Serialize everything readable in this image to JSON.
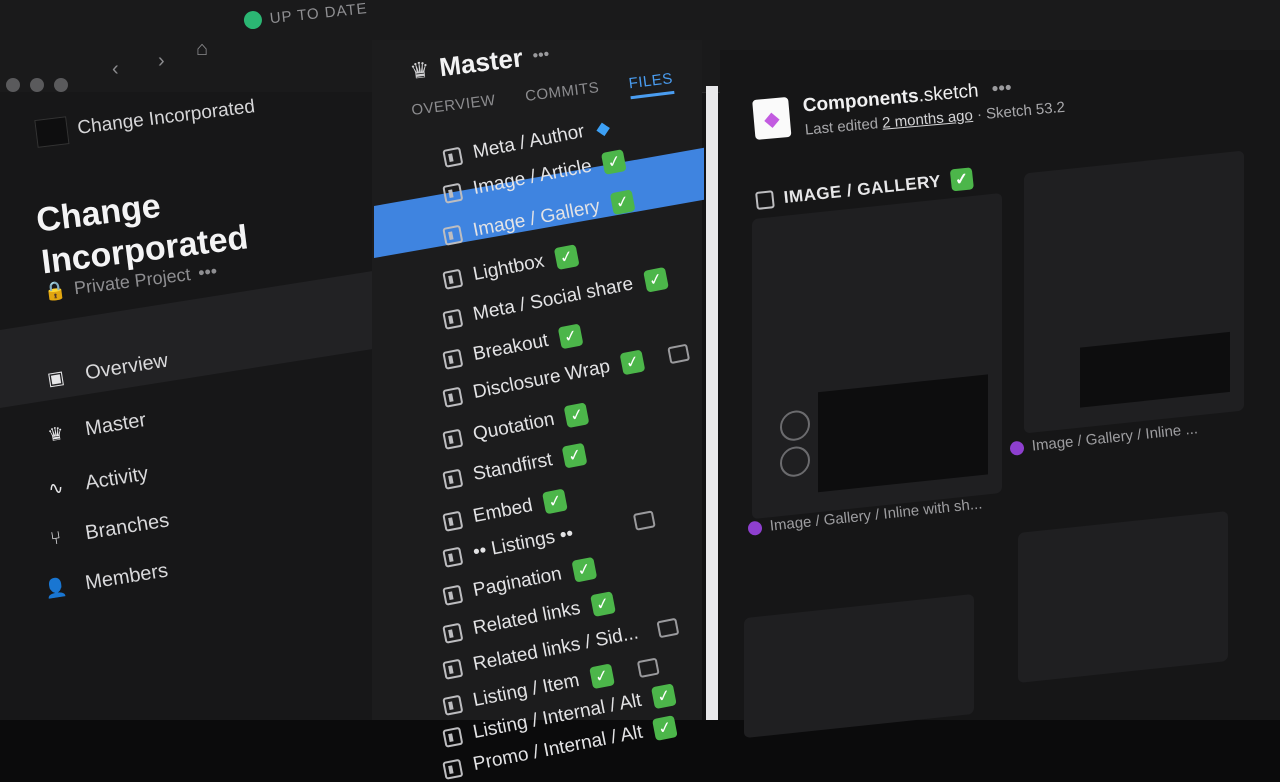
{
  "topbar": {
    "status_text": "UP TO DATE"
  },
  "sidebar": {
    "org_name": "Change Incorporated",
    "project_title": "Change Incorporated",
    "project_visibility": "Private Project",
    "items": [
      {
        "label": "Overview",
        "icon": "document-icon"
      },
      {
        "label": "Master",
        "icon": "crown-icon"
      },
      {
        "label": "Activity",
        "icon": "pulse-icon"
      },
      {
        "label": "Branches",
        "icon": "branch-icon"
      },
      {
        "label": "Members",
        "icon": "user-icon"
      }
    ]
  },
  "middle": {
    "branch_title": "Master",
    "tabs": [
      {
        "label": "OVERVIEW"
      },
      {
        "label": "COMMITS"
      },
      {
        "label": "FILES"
      }
    ],
    "files": [
      {
        "label": "Meta / Author"
      },
      {
        "label": "Image / Article"
      },
      {
        "label": "Image / Gallery"
      },
      {
        "label": "Lightbox"
      },
      {
        "label": "Meta / Social share"
      },
      {
        "label": "Breakout"
      },
      {
        "label": "Disclosure Wrap"
      },
      {
        "label": "Quotation"
      },
      {
        "label": "Standfirst"
      },
      {
        "label": "Embed"
      },
      {
        "label": "•• Listings ••"
      },
      {
        "label": "Pagination"
      },
      {
        "label": "Related links"
      },
      {
        "label": "Related links / Sid..."
      },
      {
        "label": "Listing / Item"
      },
      {
        "label": "Listing / Internal / Alt"
      },
      {
        "label": "Promo / Internal / Alt"
      }
    ]
  },
  "right": {
    "file_name_main": "Components",
    "file_name_ext": ".sketch",
    "last_edited_prefix": "Last edited",
    "last_edited_when": "2 months ago",
    "sketch_version": "· Sketch 53.2",
    "section_title": "IMAGE / GALLERY",
    "cards": [
      {
        "label": "Image / Gallery / Inline with sh..."
      },
      {
        "label": "Image / Gallery / Inline ..."
      }
    ]
  },
  "colors": {
    "accent": "#4a9df1",
    "selection": "#3f84e0",
    "check": "#4cb64a",
    "status_ok": "#2bb673"
  }
}
